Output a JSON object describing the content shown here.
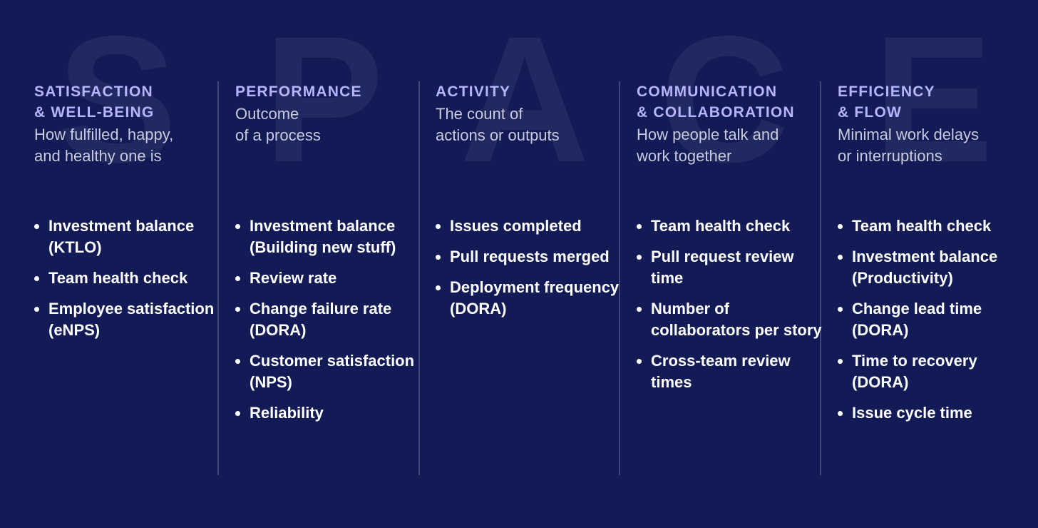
{
  "framework": {
    "name": "SPACE",
    "background_color": "#121b55",
    "heading_color": "#b7b4ff",
    "subtitle_color": "#c8cade",
    "text_color": "#ffffff",
    "divider_color": "#3f4878"
  },
  "columns": [
    {
      "letter": "S",
      "heading_lines": [
        "SATISFACTION",
        "& WELL-BEING"
      ],
      "subtitle_lines": [
        "How fulfilled, happy,",
        "and healthy one is"
      ],
      "metrics": [
        "Investment balance (KTLO)",
        "Team health check",
        "Employee satisfaction (eNPS)"
      ]
    },
    {
      "letter": "P",
      "heading_lines": [
        "PERFORMANCE"
      ],
      "subtitle_lines": [
        "Outcome",
        "of a process"
      ],
      "metrics": [
        "Investment balance (Building new stuff)",
        "Review rate",
        "Change failure rate (DORA)",
        "Customer satisfaction (NPS)",
        "Reliability"
      ]
    },
    {
      "letter": "A",
      "heading_lines": [
        "ACTIVITY"
      ],
      "subtitle_lines": [
        "The count of",
        "actions or outputs"
      ],
      "metrics": [
        "Issues completed",
        "Pull requests merged",
        "Deployment frequency (DORA)"
      ]
    },
    {
      "letter": "C",
      "heading_lines": [
        "COMMUNICATION",
        "& COLLABORATION"
      ],
      "subtitle_lines": [
        "How people talk and",
        "work together"
      ],
      "metrics": [
        "Team health check",
        "Pull request review time",
        "Number of collaborators per story",
        "Cross-team review times"
      ]
    },
    {
      "letter": "E",
      "heading_lines": [
        "EFFICIENCY",
        "& FLOW"
      ],
      "subtitle_lines": [
        "Minimal work delays",
        "or interruptions"
      ],
      "metrics": [
        "Team health check",
        "Investment balance (Productivity)",
        "Change lead time (DORA)",
        "Time to recovery (DORA)",
        "Issue cycle time"
      ]
    }
  ]
}
